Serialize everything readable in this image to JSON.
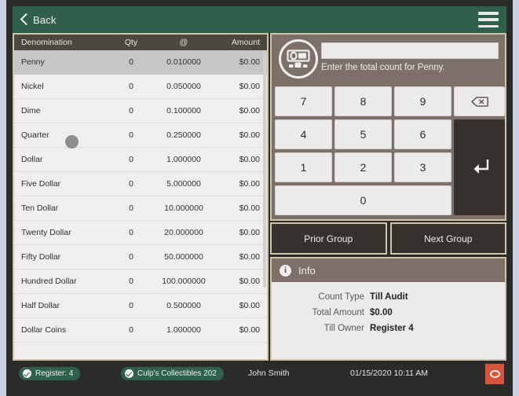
{
  "header": {
    "back_label": "Back",
    "menu_icon": "hamburger-menu-icon",
    "bg_color": "#31604a"
  },
  "table": {
    "columns": [
      "Denomination",
      "Qty",
      "@",
      "Amount"
    ],
    "selected_index": 0,
    "rows": [
      {
        "denomination": "Penny",
        "qty": "0",
        "rate": "0.010000",
        "amount": "$0.00"
      },
      {
        "denomination": "Nickel",
        "qty": "0",
        "rate": "0.050000",
        "amount": "$0.00"
      },
      {
        "denomination": "Dime",
        "qty": "0",
        "rate": "0.100000",
        "amount": "$0.00"
      },
      {
        "denomination": "Quarter",
        "qty": "0",
        "rate": "0.250000",
        "amount": "$0.00"
      },
      {
        "denomination": "Dollar",
        "qty": "0",
        "rate": "1.000000",
        "amount": "$0.00"
      },
      {
        "denomination": "Five Dollar",
        "qty": "0",
        "rate": "5.000000",
        "amount": "$0.00"
      },
      {
        "denomination": "Ten Dollar",
        "qty": "0",
        "rate": "10.000000",
        "amount": "$0.00"
      },
      {
        "denomination": "Twenty Dollar",
        "qty": "0",
        "rate": "20.000000",
        "amount": "$0.00"
      },
      {
        "denomination": "Fifty Dollar",
        "qty": "0",
        "rate": "50.000000",
        "amount": "$0.00"
      },
      {
        "denomination": "Hundred Dollar",
        "qty": "0",
        "rate": "100.000000",
        "amount": "$0.00"
      },
      {
        "denomination": "Half Dollar",
        "qty": "0",
        "rate": "0.500000",
        "amount": "$0.00"
      },
      {
        "denomination": "Dollar Coins",
        "qty": "0",
        "rate": "1.000000",
        "amount": "$0.00"
      }
    ]
  },
  "entry": {
    "icon": "cash-register-icon",
    "value": "",
    "placeholder": "",
    "hint": "Enter the total count for Penny."
  },
  "keypad": {
    "keys": [
      "7",
      "8",
      "9",
      "4",
      "5",
      "6",
      "1",
      "2",
      "3",
      "0"
    ],
    "backspace_icon": "backspace-icon",
    "enter_icon": "enter-arrow-icon"
  },
  "group_nav": {
    "prior_label": "Prior Group",
    "next_label": "Next Group"
  },
  "info": {
    "icon": "info-circle-icon",
    "title": "Info",
    "rows": [
      {
        "key": "Count Type",
        "value": "Till Audit"
      },
      {
        "key": "Total Amount",
        "value": "$0.00"
      },
      {
        "key": "Till Owner",
        "value": "Register 4"
      }
    ]
  },
  "status_bar": {
    "register_pill": "Register: 4",
    "store_pill": "Culp's Collectibles 202",
    "user": "John Smith",
    "datetime": "01/15/2020 10:11 AM",
    "power_icon": "power-off-icon",
    "power_color": "#d9543c"
  }
}
